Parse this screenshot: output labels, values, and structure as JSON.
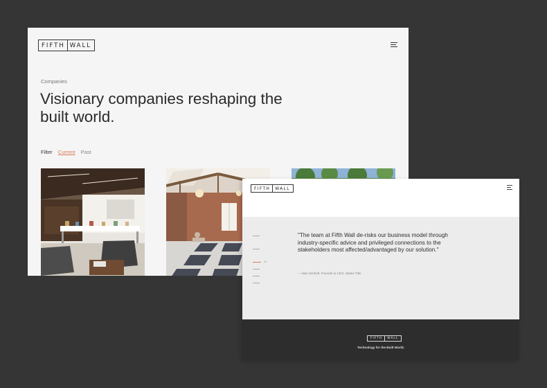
{
  "companies_page": {
    "logo": {
      "word1": "FIFTH",
      "word2": "WALL"
    },
    "breadcrumb": "Companies",
    "headline": "Visionary companies reshaping the built world.",
    "filter": {
      "label": "Filter",
      "options": [
        "Current",
        "Past"
      ],
      "selected": "Current"
    }
  },
  "testimonial_page": {
    "logo": {
      "word1": "FIFTH",
      "word2": "WALL"
    },
    "pager": {
      "current": "02"
    },
    "quote": "\"The team at Fifth Wall de-risks our business model through industry-specific advice and privileged connections to the stakeholders most affected/advantaged by our solution.\"",
    "attribution": "— Max Simkoff, Founder & CEO, States Title",
    "footer": {
      "logo": {
        "word1": "FIFTH",
        "word2": "WALL"
      },
      "tagline": "Technology for the Built World."
    }
  },
  "colors": {
    "background": "#353535",
    "accent": "#d9785a",
    "footer": "#2d2d2d"
  },
  "icons": {
    "menu": "hamburger-menu-icon"
  }
}
